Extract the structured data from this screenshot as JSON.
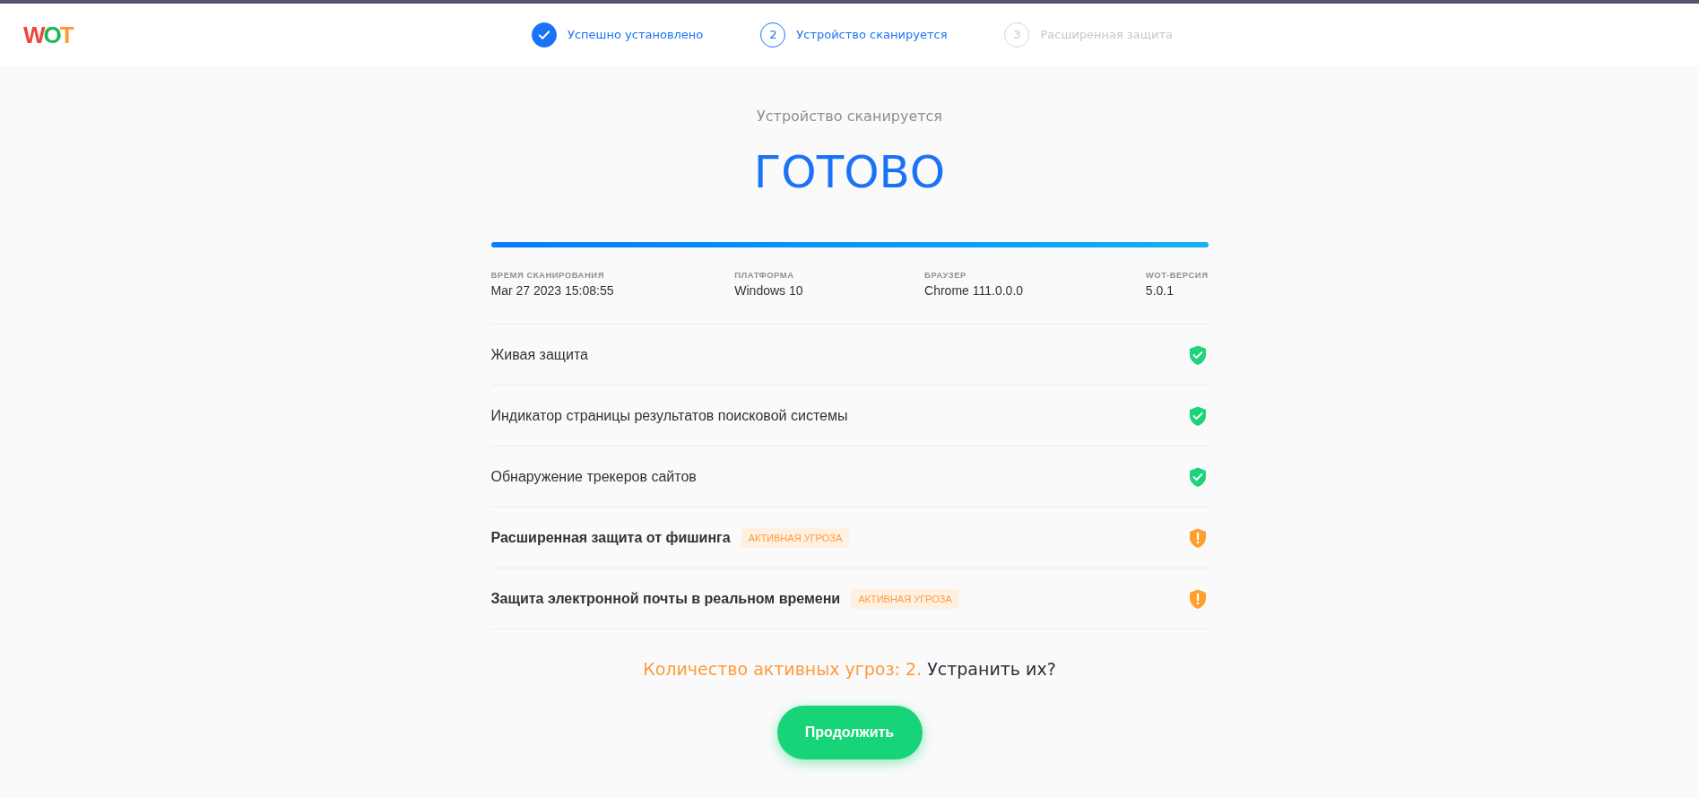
{
  "logo": {
    "text": "WOT"
  },
  "steps": [
    {
      "label": "Успешно установлено",
      "kind": "done"
    },
    {
      "number": "2",
      "label": "Устройство сканируется",
      "kind": "current"
    },
    {
      "number": "3",
      "label": "Расширенная защита",
      "kind": "pending"
    }
  ],
  "scan": {
    "subtitle": "Устройство сканируется",
    "status": "ГОТОВО",
    "progress": {
      "level": 1
    }
  },
  "info": [
    {
      "label": "ВРЕМЯ СКАНИРОВАНИЯ",
      "value": "Mar 27 2023 15:08:55"
    },
    {
      "label": "ПЛАТФОРМА",
      "value": "Windows 10"
    },
    {
      "label": "БРАУЗЕР",
      "value": "Chrome 111.0.0.0"
    },
    {
      "label": "WOT-ВЕРСИЯ",
      "value": "5.0.1"
    }
  ],
  "checks": [
    {
      "name": "Живая защита",
      "kind": "ok"
    },
    {
      "name": "Индикатор страницы результатов поисковой системы",
      "kind": "ok"
    },
    {
      "name": "Обнаружение трекеров сайтов",
      "kind": "ok"
    },
    {
      "name": "Расширенная защита от фишинга",
      "kind": "threat",
      "badge": "АКТИВНАЯ УГРОЗА"
    },
    {
      "name": "Защита электронной почты в реальном времени",
      "kind": "threat",
      "badge": "АКТИВНАЯ УГРОЗА"
    }
  ],
  "summary": {
    "count_text": "Количество активных угроз: 2.",
    "question": "Устранить их?"
  },
  "continue_button": "Продолжить"
}
